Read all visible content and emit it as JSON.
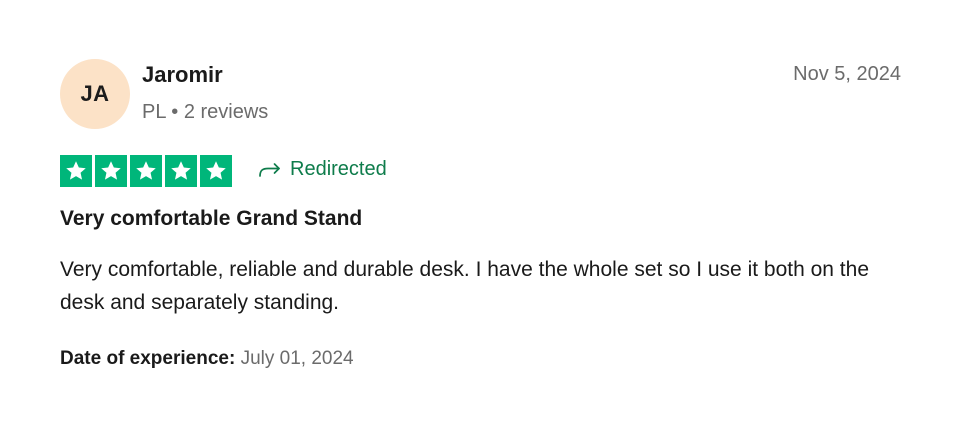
{
  "reviewer": {
    "initials": "JA",
    "name": "Jaromir",
    "meta": "PL • 2 reviews",
    "avatar_color": "#fce2c7"
  },
  "review": {
    "date": "Nov 5, 2024",
    "rating": 5,
    "max_rating": 5,
    "star_color": "#00b67a",
    "redirected_label": "Redirected",
    "redirected_icon": "redirect-arrow-icon",
    "title": "Very comfortable Grand Stand",
    "body": "Very comfortable, reliable and durable desk. I have the whole set so I use it both on the desk and separately standing.",
    "experience_label": "Date of experience:",
    "experience_date": "July 01, 2024"
  }
}
